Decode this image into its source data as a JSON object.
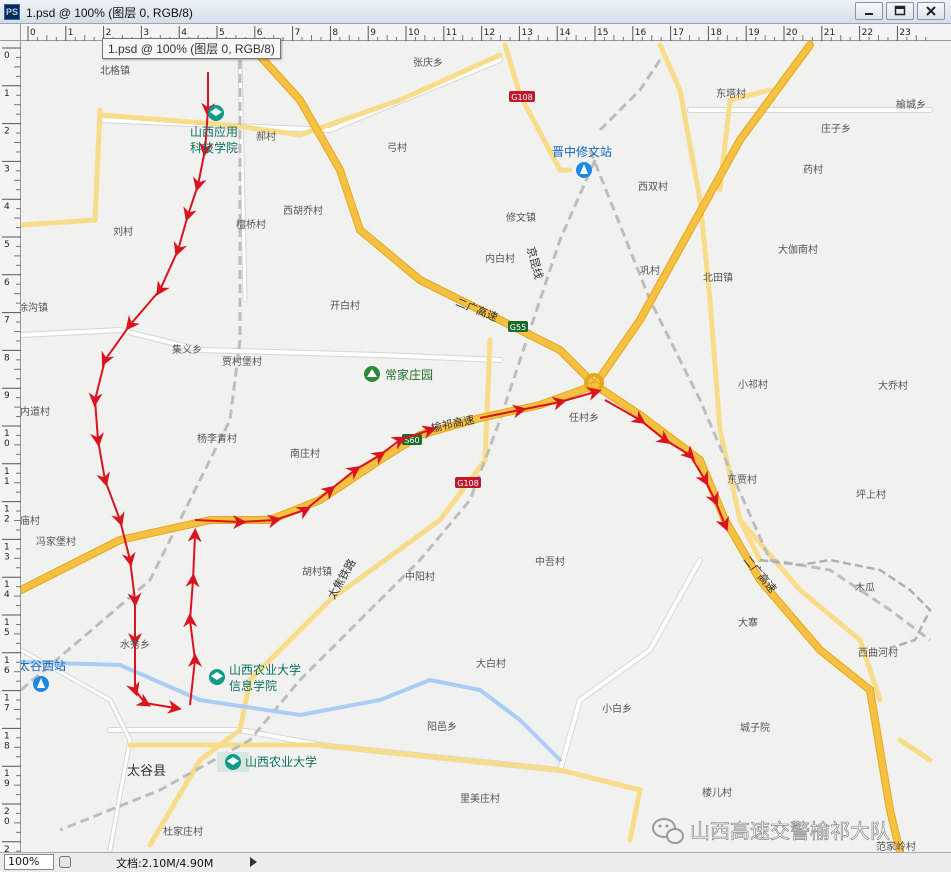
{
  "window": {
    "app_icon": "PS",
    "title": "1.psd @ 100% (图层 0, RGB/8)",
    "tooltip": "1.psd @ 100% (图层 0, RGB/8)"
  },
  "ruler": {
    "top_ticks": [
      "0",
      "1",
      "2",
      "3",
      "4",
      "5",
      "6",
      "7",
      "8",
      "9",
      "10",
      "11",
      "12",
      "13",
      "14",
      "15",
      "16",
      "17",
      "18",
      "19",
      "20",
      "21",
      "22",
      "23"
    ],
    "left_ticks": [
      "0",
      "1",
      "2",
      "3",
      "4",
      "5",
      "6",
      "7",
      "8",
      "9",
      "10",
      "11",
      "12",
      "13",
      "14",
      "15",
      "16",
      "17",
      "18",
      "19",
      "20",
      "21"
    ]
  },
  "statusbar": {
    "zoom": "100%",
    "doc_info": "文档:2.10M/4.90M"
  },
  "map": {
    "places": [
      "北格镇",
      "张庆乡",
      "东塔村",
      "榆城乡",
      "郝村",
      "弓村",
      "庄子乡",
      "药村",
      "西双村",
      "西胡乔村",
      "修文镇",
      "刘村",
      "檀桥村",
      "大伽南村",
      "内白村",
      "北田镇",
      "巩村",
      "开白村",
      "徐沟镇",
      "集义乡",
      "贾村堡村",
      "小祁村",
      "大乔村",
      "内道村",
      "任村乡",
      "杨李青村",
      "南庄村",
      "东贾村",
      "坪上村",
      "庙村",
      "冯家堡村",
      "胡村镇",
      "中阳村",
      "中吾村",
      "木瓜",
      "水秀乡",
      "大寨",
      "西曲河村",
      "大白村",
      "小白乡",
      "阳邑乡",
      "城子院",
      "楼儿村",
      "里美庄村",
      "杜家庄村",
      "范家岭村"
    ],
    "landmarks": {
      "college1_line1": "山西应用",
      "college1_line2": "科技学院",
      "station1": "晋中修文站",
      "park": "常家庄园",
      "college2_line1": "山西农业大学",
      "college2_line2": "信息学院",
      "station2": "太谷西站",
      "university": "山西农业大学",
      "county": "太谷县"
    },
    "road_shields": [
      "G108",
      "G55",
      "S60",
      "G108"
    ],
    "road_labels": {
      "erguang": "二广高速",
      "yuqi": "榆祁高速",
      "jingkun": "京昆线",
      "taijiao": "太焦铁路",
      "erguang2": "二广高速"
    }
  },
  "watermark": "山西高速交警榆祁大队",
  "colors": {
    "highway": "#f6c142",
    "highway_edge": "#e3a81b",
    "arrow": "#d9141e",
    "water": "#a9cdf5",
    "railway": "#b4b4b4",
    "shield_national": "#c0182b",
    "shield_provincial": "#1c6b2a",
    "poi_blue": "#1e88e5",
    "poi_teal": "#0f9a8c",
    "park_green": "#2e8b3c"
  }
}
